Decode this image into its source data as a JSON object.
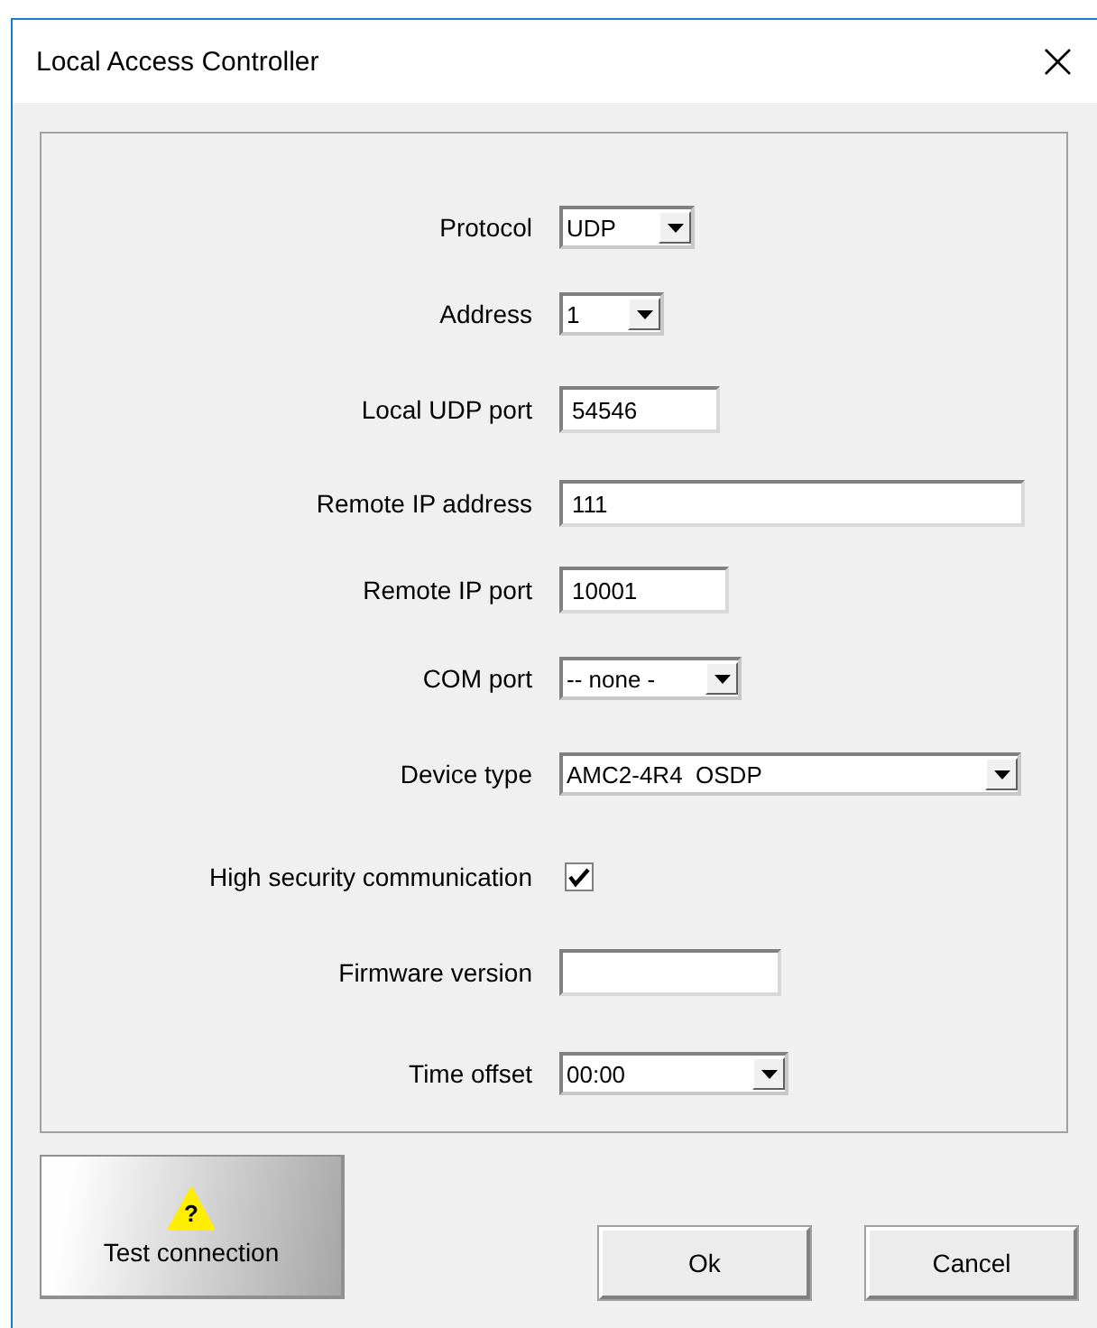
{
  "window": {
    "title": "Local Access Controller",
    "close": "×"
  },
  "fields": [
    {
      "label": "Protocol",
      "kind": "select",
      "value": "UDP"
    },
    {
      "label": "Address",
      "kind": "select",
      "value": "1"
    },
    {
      "label": "Local UDP port",
      "kind": "text",
      "value": "54546"
    },
    {
      "label": "Remote IP address",
      "kind": "text",
      "value": "111"
    },
    {
      "label": "Remote IP port",
      "kind": "text",
      "value": "10001"
    },
    {
      "label": "COM port",
      "kind": "select",
      "value": "-- none -"
    },
    {
      "label": "Device type",
      "kind": "select",
      "value": "AMC2-4R4  OSDP"
    },
    {
      "label": "High security communication",
      "kind": "checkbox",
      "checked": true
    },
    {
      "label": "Firmware version",
      "kind": "text"
    },
    {
      "label": "Time offset",
      "kind": "select",
      "value": "00:00"
    }
  ],
  "buttons": {
    "test_icon": "?",
    "test": "Test connection",
    "ok": "Ok",
    "cancel": "Cancel"
  }
}
